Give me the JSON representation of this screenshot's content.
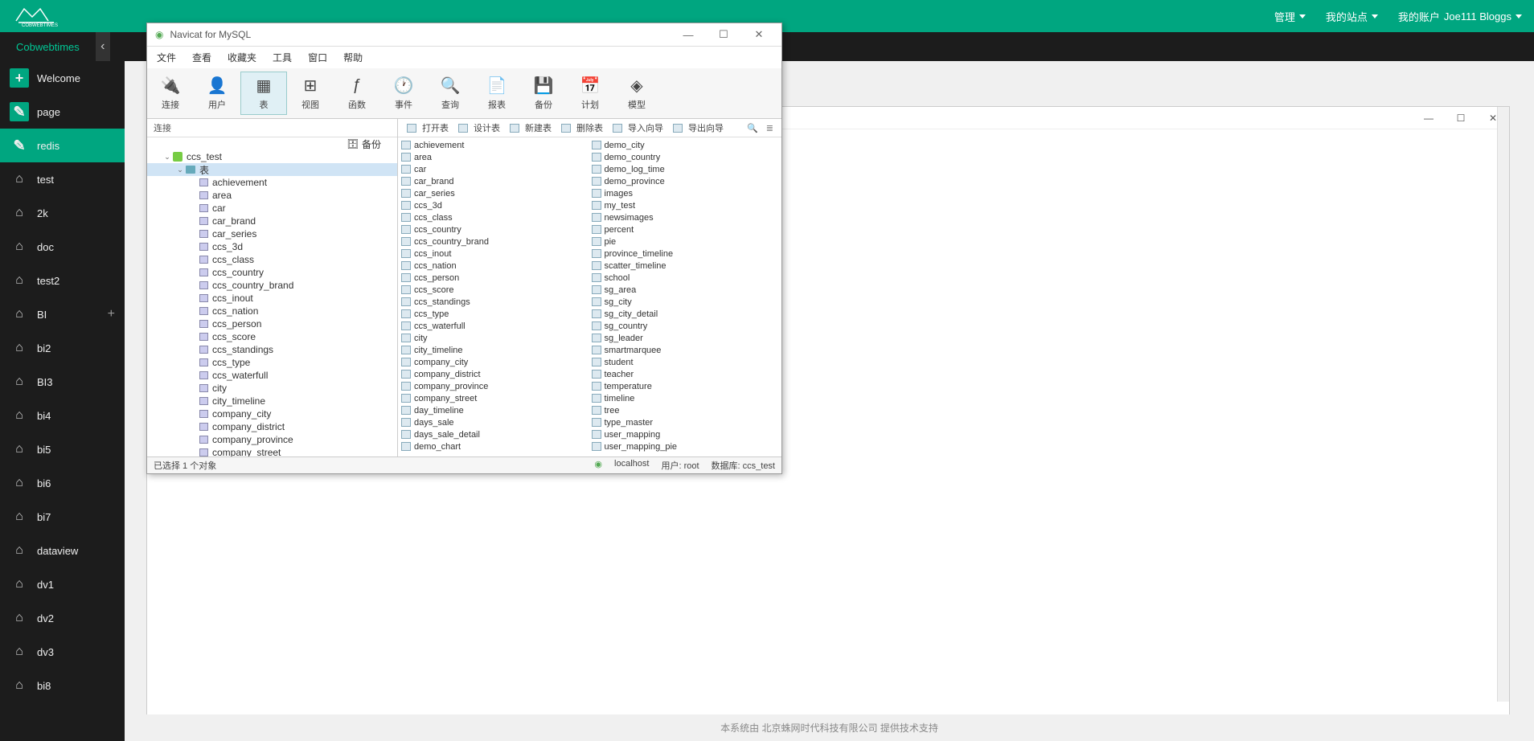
{
  "header": {
    "menu1": "管理",
    "menu2": "我的站点",
    "menu3_prefix": "我的账户",
    "account_name": "Joe111 Bloggs"
  },
  "tab": {
    "name": "Cobwebtimes"
  },
  "sidebar": {
    "items": [
      {
        "label": "Welcome",
        "icon": "plus",
        "active": false
      },
      {
        "label": "page",
        "icon": "edit",
        "active": false
      },
      {
        "label": "redis",
        "icon": "edit",
        "active": true
      },
      {
        "label": "test",
        "icon": "home",
        "active": false
      },
      {
        "label": "2k",
        "icon": "home",
        "active": false
      },
      {
        "label": "doc",
        "icon": "home",
        "active": false
      },
      {
        "label": "test2",
        "icon": "home",
        "active": false
      },
      {
        "label": "BI",
        "icon": "home",
        "active": false,
        "hasPlus": true
      },
      {
        "label": "bi2",
        "icon": "home",
        "active": false
      },
      {
        "label": "BI3",
        "icon": "home",
        "active": false
      },
      {
        "label": "bi4",
        "icon": "home",
        "active": false
      },
      {
        "label": "bi5",
        "icon": "home",
        "active": false
      },
      {
        "label": "bi6",
        "icon": "home",
        "active": false
      },
      {
        "label": "bi7",
        "icon": "home",
        "active": false
      },
      {
        "label": "dataview",
        "icon": "home",
        "active": false
      },
      {
        "label": "dv1",
        "icon": "home",
        "active": false
      },
      {
        "label": "dv2",
        "icon": "home",
        "active": false
      },
      {
        "label": "dv3",
        "icon": "home",
        "active": false
      },
      {
        "label": "bi8",
        "icon": "home",
        "active": false
      }
    ]
  },
  "navicat": {
    "title": "Navicat for MySQL",
    "menus": [
      "文件",
      "查看",
      "收藏夹",
      "工具",
      "窗口",
      "帮助"
    ],
    "tools": [
      {
        "label": "连接",
        "active": false
      },
      {
        "label": "用户",
        "active": false
      },
      {
        "label": "表",
        "active": true
      },
      {
        "label": "视图",
        "active": false
      },
      {
        "label": "函数",
        "active": false
      },
      {
        "label": "事件",
        "active": false
      },
      {
        "label": "查询",
        "active": false
      },
      {
        "label": "报表",
        "active": false
      },
      {
        "label": "备份",
        "active": false
      },
      {
        "label": "计划",
        "active": false
      },
      {
        "label": "模型",
        "active": false
      }
    ],
    "tree_header": "连接",
    "tree": {
      "backup": "备份",
      "db": "ccs_test",
      "table_folder": "表",
      "tables": [
        "achievement",
        "area",
        "car",
        "car_brand",
        "car_series",
        "ccs_3d",
        "ccs_class",
        "ccs_country",
        "ccs_country_brand",
        "ccs_inout",
        "ccs_nation",
        "ccs_person",
        "ccs_score",
        "ccs_standings",
        "ccs_type",
        "ccs_waterfull",
        "city",
        "city_timeline",
        "company_city",
        "company_district",
        "company_province",
        "company_street"
      ]
    },
    "list_toolbar": [
      "打开表",
      "设计表",
      "新建表",
      "删除表",
      "导入向导",
      "导出向导"
    ],
    "list_col1": [
      "achievement",
      "area",
      "car",
      "car_brand",
      "car_series",
      "ccs_3d",
      "ccs_class",
      "ccs_country",
      "ccs_country_brand",
      "ccs_inout",
      "ccs_nation",
      "ccs_person",
      "ccs_score",
      "ccs_standings",
      "ccs_type",
      "ccs_waterfull",
      "city",
      "city_timeline",
      "company_city",
      "company_district",
      "company_province",
      "company_street",
      "day_timeline",
      "days_sale",
      "days_sale_detail",
      "demo_chart"
    ],
    "list_col2": [
      "demo_city",
      "demo_country",
      "demo_log_time",
      "demo_province",
      "images",
      "my_test",
      "newsimages",
      "percent",
      "pie",
      "province_timeline",
      "scatter_timeline",
      "school",
      "sg_area",
      "sg_city",
      "sg_city_detail",
      "sg_country",
      "sg_leader",
      "smartmarquee",
      "student",
      "teacher",
      "temperature",
      "timeline",
      "tree",
      "type_master",
      "user_mapping",
      "user_mapping_pie"
    ],
    "status": {
      "selection": "已选择 1 个对象",
      "host": "localhost",
      "user": "用户: root",
      "db": "数据库: ccs_test"
    }
  },
  "footer": {
    "text": "本系统由 北京蛛网时代科技有限公司 提供技术支持"
  }
}
